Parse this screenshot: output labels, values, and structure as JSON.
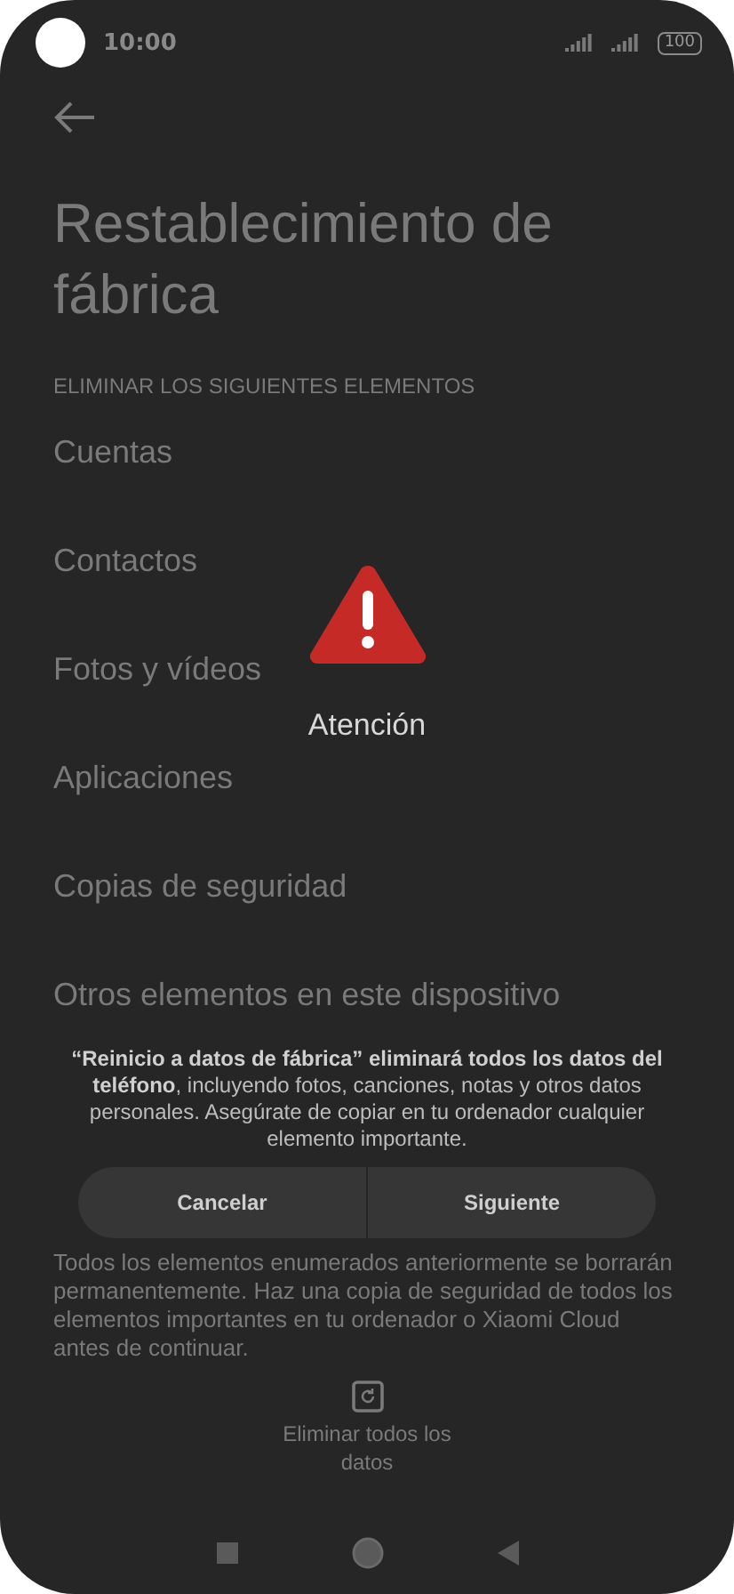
{
  "status_bar": {
    "time": "10:00",
    "battery": "100"
  },
  "header": {
    "title": "Restablecimiento de fábrica"
  },
  "section_header": "ELIMINAR LOS SIGUIENTES ELEMENTOS",
  "items": [
    "Cuentas",
    "Contactos",
    "Fotos y vídeos",
    "Aplicaciones",
    "Copias de seguridad",
    "Otros elementos en este dispositivo"
  ],
  "footer_note": "Todos los elementos enumerados anteriormente se borrarán permanentemente. Haz una copia de seguridad de todos los elementos importantes en tu ordenador o Xiaomi Cloud antes de continuar.",
  "action": {
    "label": "Eliminar todos los datos"
  },
  "dialog": {
    "title": "Atención",
    "message": "**“Reinicio a datos de fábrica” eliminará todos los datos del teléfono**, incluyendo fotos, canciones, notas y otros datos personales. Asegúrate de copiar en tu ordenador cualquier elemento importante.",
    "buttons": [
      {
        "label": "Cancelar"
      },
      {
        "label": "Siguiente"
      }
    ]
  }
}
